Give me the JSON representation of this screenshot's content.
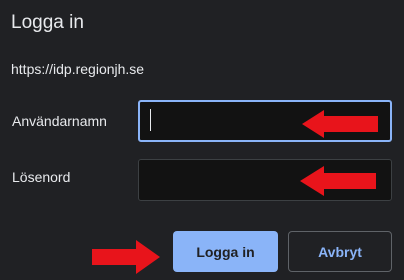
{
  "dialog": {
    "title": "Logga in",
    "origin": "https://idp.regionjh.se"
  },
  "form": {
    "username_label": "Användarnamn",
    "username_value": "",
    "password_label": "Lösenord",
    "password_value": ""
  },
  "buttons": {
    "login_label": "Logga in",
    "cancel_label": "Avbryt"
  },
  "annotations": {
    "arrow_color": "#e8141b",
    "icon": "arrow-icon"
  },
  "colors": {
    "accent": "#8ab4f8",
    "background": "#202124"
  }
}
